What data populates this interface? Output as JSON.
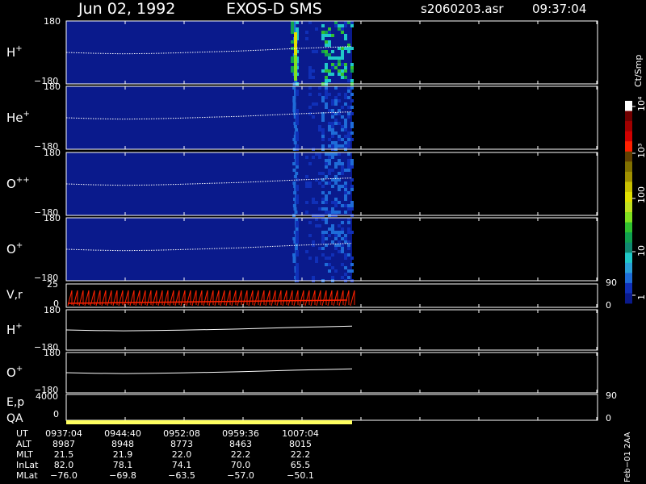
{
  "header": {
    "date": "Jun 02, 1992",
    "mission": "EXOS-D SMS",
    "file": "s2060203.asr",
    "time": "09:37:04"
  },
  "colorbar": {
    "label": "Ct/Smp",
    "ticks": [
      "1",
      "10",
      "100",
      "10³",
      "10⁴"
    ],
    "colors": [
      "#0a1a8c",
      "#1030b8",
      "#1e6cd8",
      "#2aa0d8",
      "#20c8c8",
      "#108870",
      "#10a050",
      "#30c030",
      "#80e020",
      "#c0e020",
      "#e0e000",
      "#c8c000",
      "#a09000",
      "#807000",
      "#604000",
      "#ff2000",
      "#d00000",
      "#a00000",
      "#700000",
      "#ffffff"
    ]
  },
  "panels": [
    {
      "label": "H",
      "sup": "+",
      "ymax": "180",
      "ymin": "−180"
    },
    {
      "label": "He",
      "sup": "+",
      "ymax": "180",
      "ymin": "−180"
    },
    {
      "label": "O",
      "sup": "++",
      "ymax": "180",
      "ymin": "−180"
    },
    {
      "label": "O",
      "sup": "+",
      "ymax": "180",
      "ymin": "−180"
    }
  ],
  "vr_panel": {
    "label": "V,r",
    "ymax": "25",
    "ymin": "0",
    "right_top": "90",
    "right_bottom": "0"
  },
  "line_panels": [
    {
      "label": "H",
      "sup": "+",
      "ymax": "180",
      "ymin": "−180"
    },
    {
      "label": "O",
      "sup": "+",
      "ymax": "180",
      "ymin": "−180"
    }
  ],
  "ep_panel": {
    "label": "E,p",
    "ymax": "4000",
    "ymin": "0",
    "right_top": "90",
    "right_bottom": "0"
  },
  "qa_panel": {
    "label": "QA"
  },
  "footer": {
    "rows": [
      {
        "label": "UT",
        "values": [
          "0937:04",
          "0944:40",
          "0952:08",
          "0959:36",
          "1007:04"
        ]
      },
      {
        "label": "ALT",
        "values": [
          "8987",
          "8948",
          "8773",
          "8463",
          "8015"
        ]
      },
      {
        "label": "MLT",
        "values": [
          "21.5",
          "21.9",
          "22.0",
          "22.2",
          "22.2"
        ]
      },
      {
        "label": "InLat",
        "values": [
          "82.0",
          "78.1",
          "74.1",
          "70.0",
          "65.5"
        ]
      },
      {
        "label": "MLat",
        "values": [
          "−76.0",
          "−69.8",
          "−63.5",
          "−57.0",
          "−50.1"
        ]
      }
    ],
    "side_label": "Feb−01 2AA"
  },
  "chart_data": {
    "type": "heatmap",
    "title": "Jun 02, 1992   EXOS-D SMS",
    "x_tick_labels": [
      "0937:04",
      "0944:40",
      "0952:08",
      "0959:36",
      "1007:04"
    ],
    "ylim": [
      -180,
      180
    ],
    "panels": [
      "H+",
      "He+",
      "O++",
      "O+"
    ],
    "pitch_trace": [
      {
        "x": 0,
        "y": 0
      },
      {
        "x": 0.1,
        "y": -5
      },
      {
        "x": 0.2,
        "y": -8
      },
      {
        "x": 0.3,
        "y": -6
      },
      {
        "x": 0.4,
        "y": -2
      },
      {
        "x": 0.5,
        "y": 3
      },
      {
        "x": 0.6,
        "y": 8
      },
      {
        "x": 0.7,
        "y": 15
      },
      {
        "x": 0.8,
        "y": 22
      },
      {
        "x": 0.9,
        "y": 28
      },
      {
        "x": 1.0,
        "y": 34
      }
    ],
    "scale": "log",
    "colorbar_label": "Ct/Smp"
  }
}
